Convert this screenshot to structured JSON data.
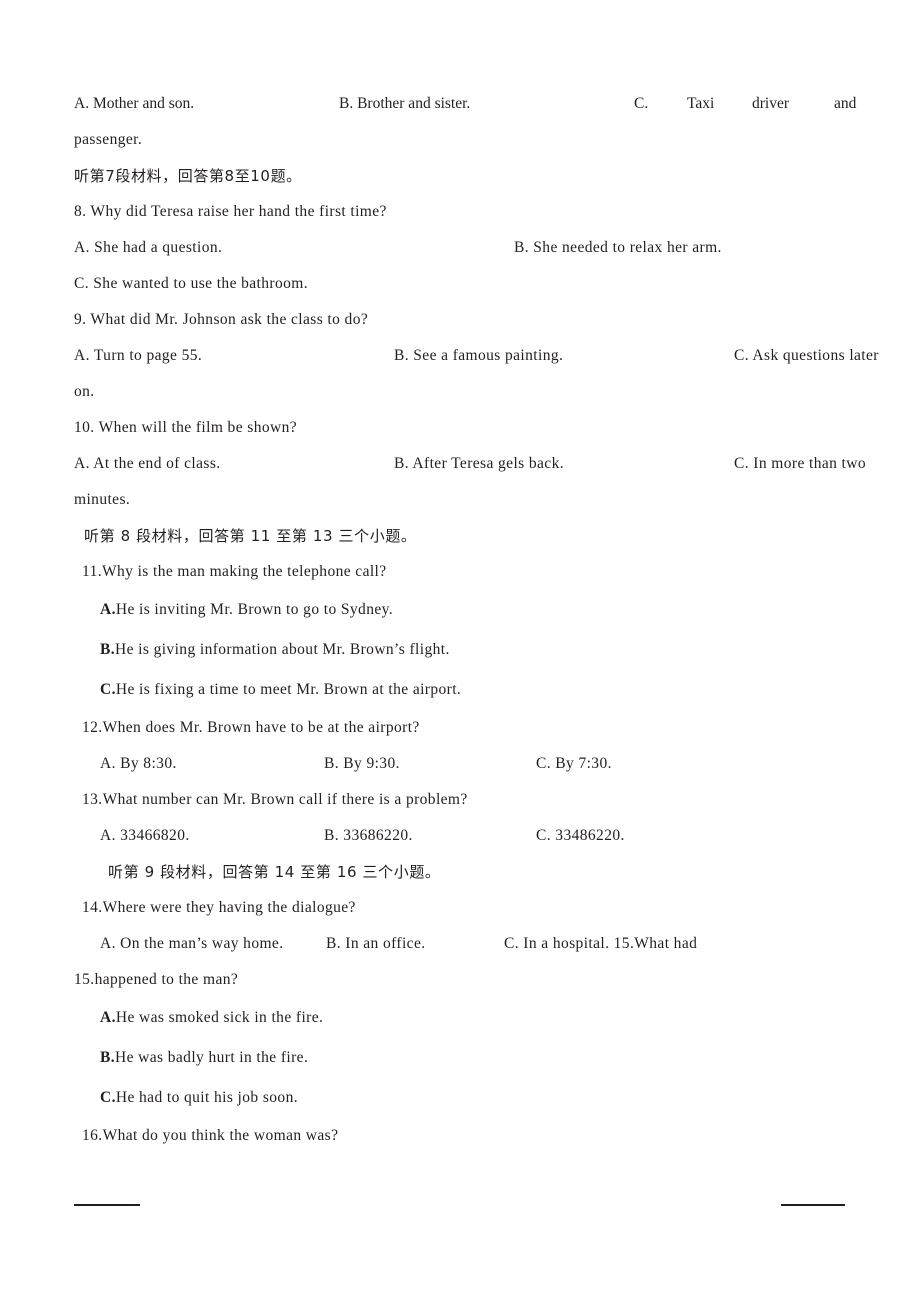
{
  "document": {
    "type": "english-listening-exam",
    "language_mix": [
      "en",
      "zh"
    ]
  },
  "lines": {
    "q7_opt_a": "A. Mother and son.",
    "q7_opt_b": "B. Brother and sister.",
    "q7_opt_c_label": "C.",
    "q7_opt_c_w1": "Taxi",
    "q7_opt_c_w2": "driver",
    "q7_opt_c_w3": "and",
    "q7_opt_c_cont": "passenger.",
    "section7_header": "听第7段材料，回答第8至10题。",
    "q8_stem": "8. Why did Teresa raise her hand the first time?",
    "q8_opt_a": "A. She had a question.",
    "q8_opt_b": "B. She needed to relax her arm.",
    "q8_opt_c": "C. She wanted to use the bathroom.",
    "q9_stem": "9. What did Mr. Johnson ask the class to do?",
    "q9_opt_a": "A. Turn to page 55.",
    "q9_opt_b": "B. See a famous painting.",
    "q9_opt_c": "C. Ask questions later",
    "q9_opt_c_cont": "on.",
    "q10_stem": "10. When will the film be shown?",
    "q10_opt_a": "A. At the end of class.",
    "q10_opt_b": "B. After Teresa gels back.",
    "q10_opt_c": "C. In more than two",
    "q10_opt_c_cont": "minutes.",
    "section8_header": "听第 8 段材料，回答第 11 至第 13 三个小题。",
    "q11_stem": "11.Why is the man making the telephone call?",
    "q11_opt_a_label": "A.",
    "q11_opt_a_text": "He is inviting Mr. Brown to go to Sydney.",
    "q11_opt_b_label": "B.",
    "q11_opt_b_text": "He is giving information about Mr. Brown’s flight.",
    "q11_opt_c_label": "C.",
    "q11_opt_c_text": "He is fixing a time to meet Mr. Brown at the airport.",
    "q12_stem": "12.When does Mr. Brown have to be at the airport?",
    "q12_opt_a": "A. By 8:30.",
    "q12_opt_b": "B. By 9:30.",
    "q12_opt_c": "C. By 7:30.",
    "q13_stem": "13.What number can Mr. Brown call if there is a problem?",
    "q13_opt_a": "A. 33466820.",
    "q13_opt_b": "B. 33686220.",
    "q13_opt_c": "C. 33486220.",
    "section9_header": "听第 9 段材料，回答第 14 至第 16 三个小题。",
    "q14_stem": "14.Where were they having the dialogue?",
    "q14_opt_a": "A. On the man’s way home.",
    "q14_opt_b": "B. In an office.",
    "q14_opt_c": "C. In a hospital. 15.What had",
    "q15_stem": "15.happened to the man?",
    "q15_opt_a_label": "A.",
    "q15_opt_a_text": "He was smoked sick in the fire.",
    "q15_opt_b_label": "B.",
    "q15_opt_b_text": "He was badly hurt in the fire.",
    "q15_opt_c_label": "C.",
    "q15_opt_c_text": "He had to quit his job soon.",
    "q16_stem": "16.What do you think the woman was?"
  },
  "colors": {
    "text": "#231f20",
    "background": "#ffffff",
    "rule": "#231f20"
  }
}
